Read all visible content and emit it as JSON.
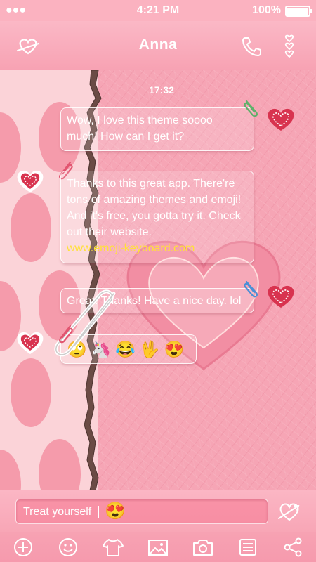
{
  "status_bar": {
    "time": "4:21 PM",
    "battery": "100%"
  },
  "header": {
    "contact_name": "Anna"
  },
  "chat": {
    "timestamp": "17:32",
    "messages": [
      {
        "direction": "outgoing",
        "lines": [
          "Wow, I love this theme soooo",
          "much! How can I get it?"
        ]
      },
      {
        "direction": "incoming",
        "lines": [
          "Thanks to this great app. There're",
          "tons of amazing themes and emoji!",
          "And it's free, you gotta try it. Check",
          "out their website."
        ],
        "link": "www.emoji-keyboard.com"
      },
      {
        "direction": "outgoing",
        "lines": [
          "Great! Thanks! Have a nice day. lol"
        ]
      },
      {
        "direction": "incoming",
        "emojis": [
          "🙄",
          "🦄",
          "😂",
          "🖖",
          "😍"
        ]
      }
    ]
  },
  "composer": {
    "text": "Treat yourself",
    "emoji": "😍"
  },
  "toolbar": {
    "icons": [
      "add-icon",
      "smiley-icon",
      "tshirt-icon",
      "image-icon",
      "camera-icon",
      "list-icon",
      "share-icon"
    ]
  },
  "colors": {
    "accent": "#f7a2b3",
    "link": "#ffe13a",
    "heart": "#d8334f"
  }
}
